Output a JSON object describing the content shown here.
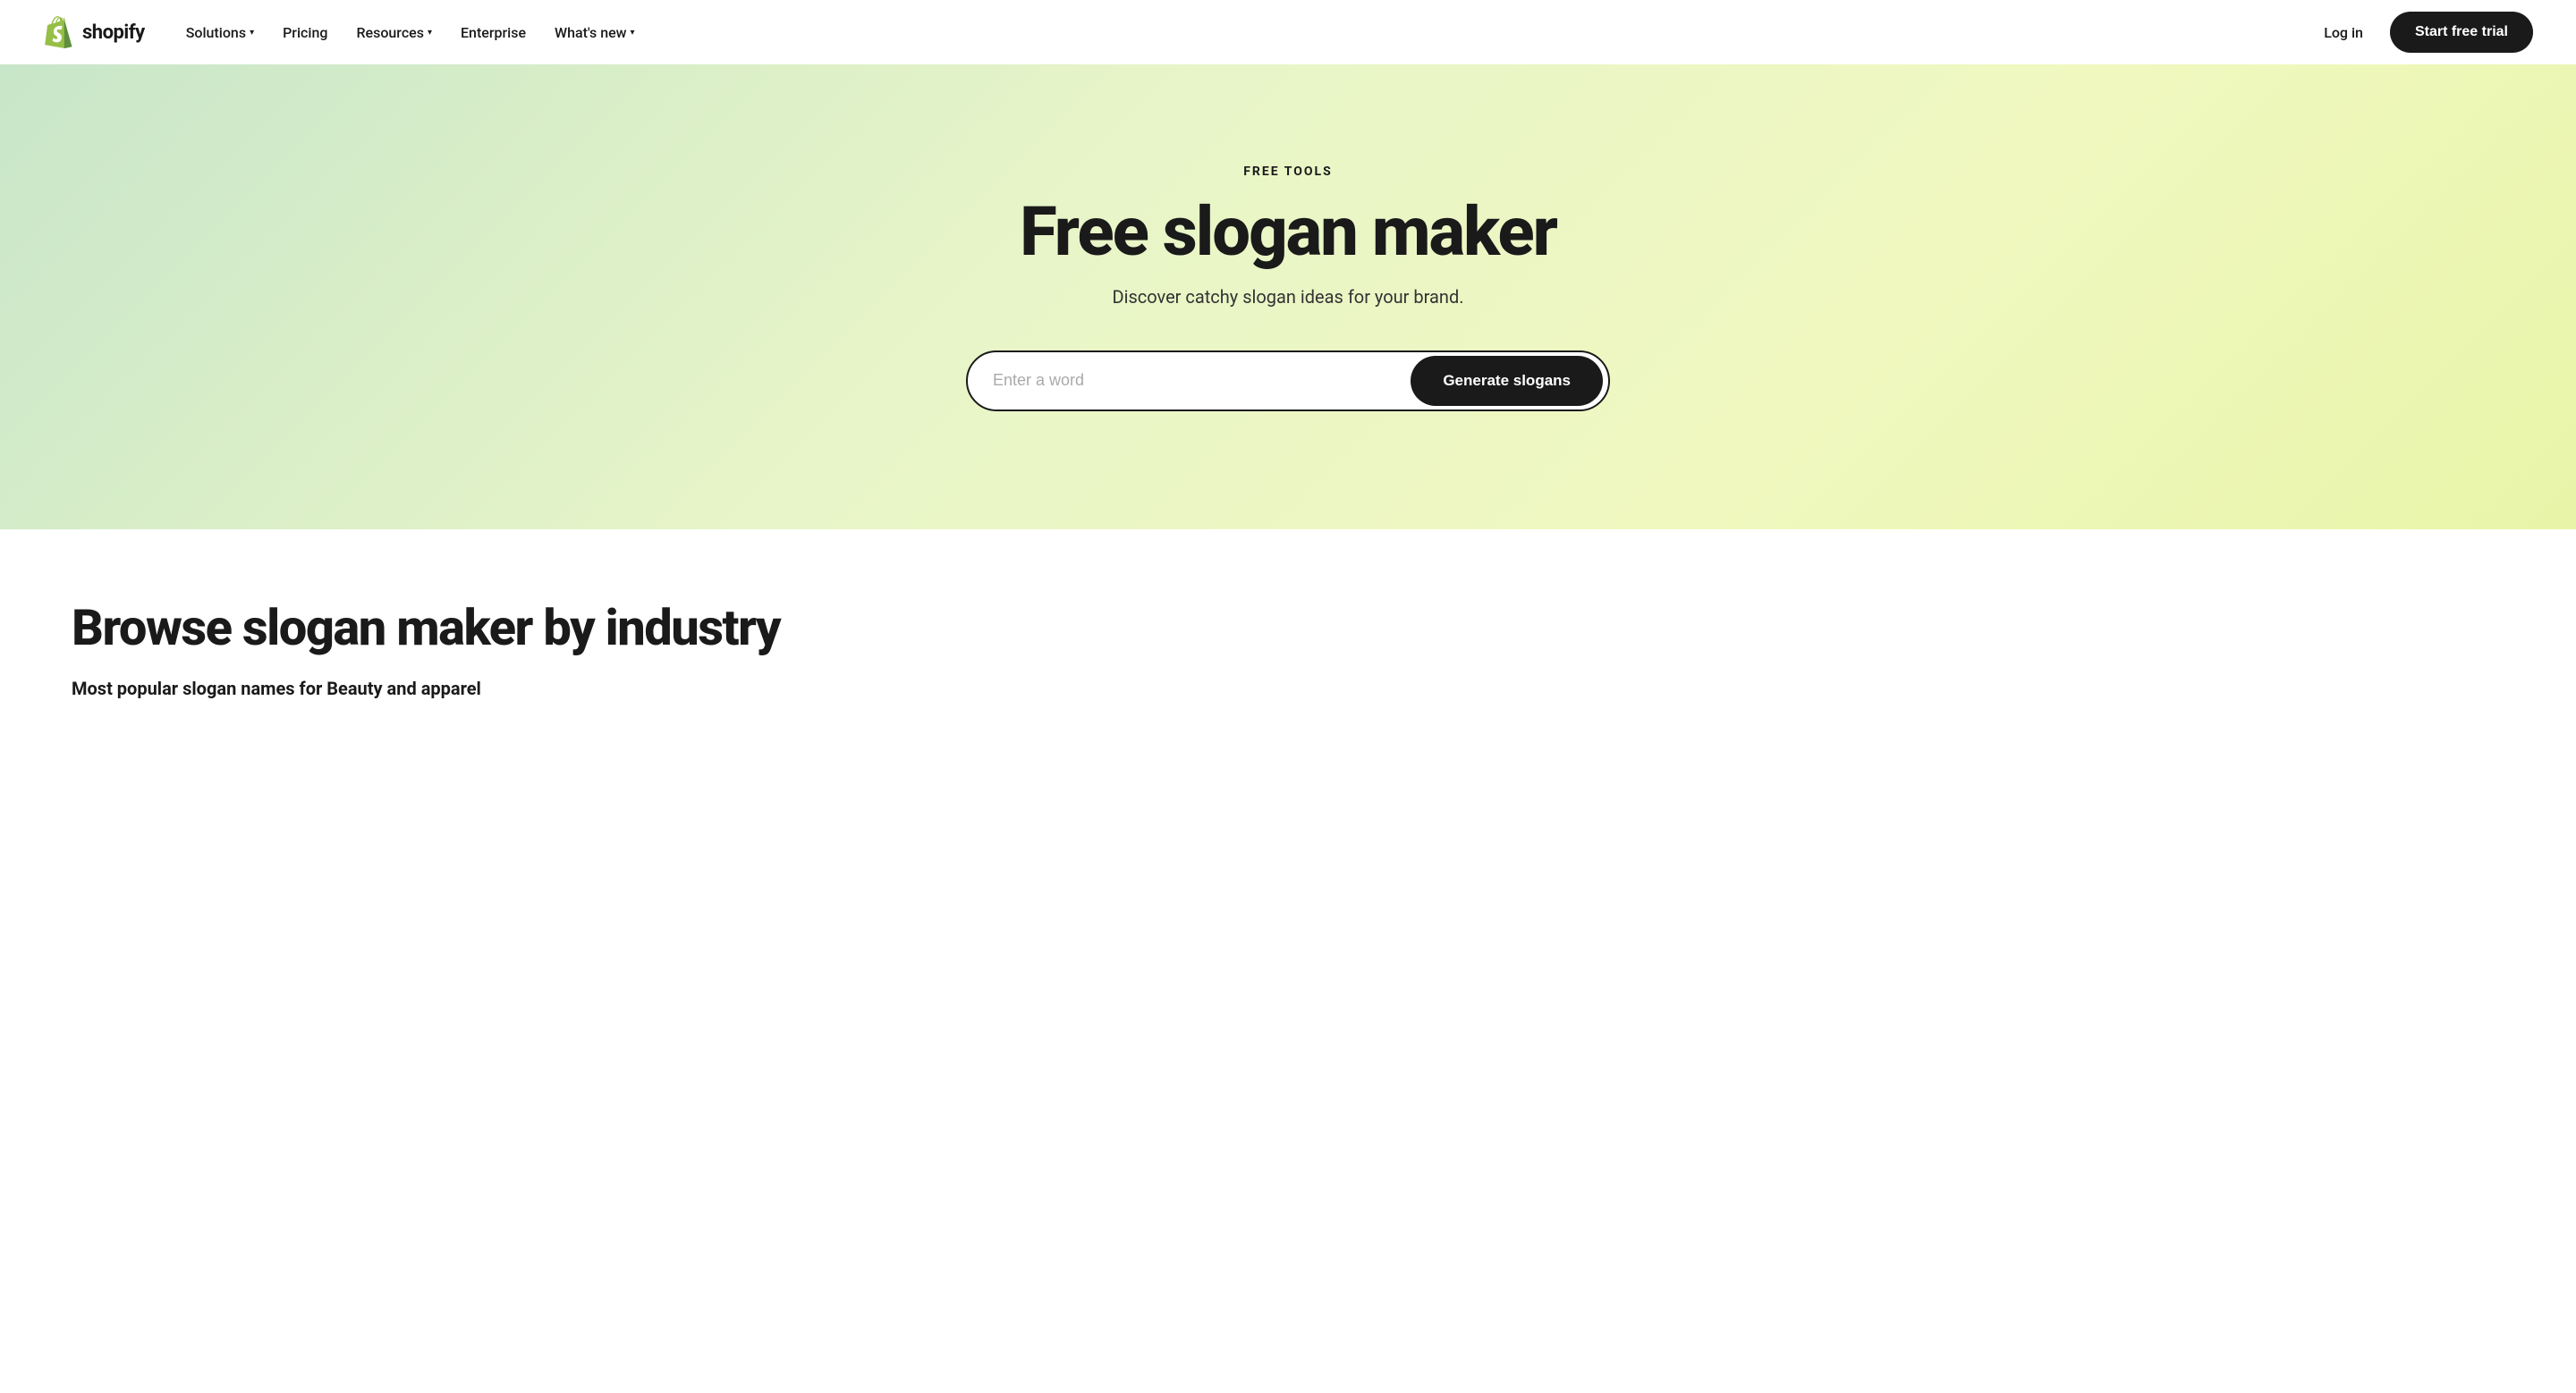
{
  "nav": {
    "logo_text": "shopify",
    "links": [
      {
        "label": "Solutions",
        "has_dropdown": true
      },
      {
        "label": "Pricing",
        "has_dropdown": false
      },
      {
        "label": "Resources",
        "has_dropdown": true
      },
      {
        "label": "Enterprise",
        "has_dropdown": false
      },
      {
        "label": "What's new",
        "has_dropdown": true
      }
    ],
    "login_label": "Log in",
    "trial_label": "Start free trial"
  },
  "hero": {
    "eyebrow": "FREE TOOLS",
    "title": "Free slogan maker",
    "subtitle": "Discover catchy slogan ideas for your brand.",
    "input_placeholder": "Enter a word",
    "generate_label": "Generate slogans"
  },
  "below": {
    "browse_title": "Browse slogan maker by industry",
    "popular_label": "Most popular slogan names for Beauty and apparel"
  }
}
